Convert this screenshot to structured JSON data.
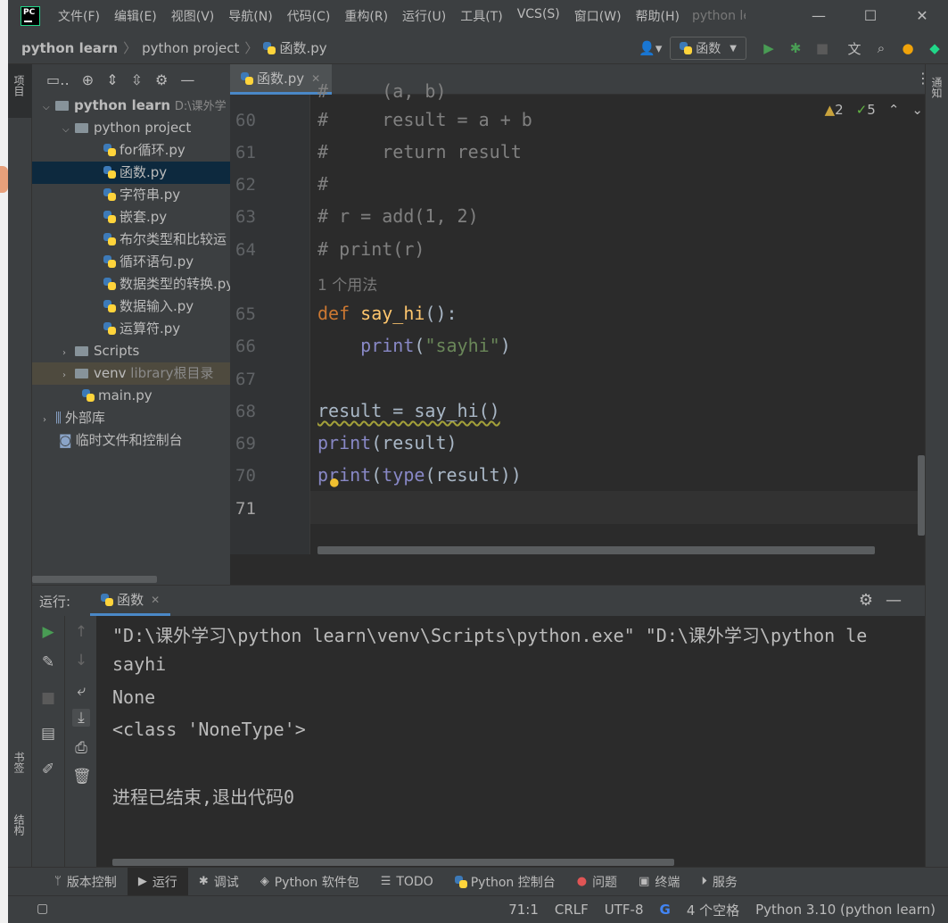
{
  "menu": [
    "文件(F)",
    "编辑(E)",
    "视图(V)",
    "导航(N)",
    "代码(C)",
    "重构(R)",
    "运行(U)",
    "工具(T)",
    "VCS(S)",
    "窗口(W)",
    "帮助(H)"
  ],
  "window_title": "python learn",
  "breadcrumb": {
    "root": "python learn",
    "folder": "python project",
    "file": "函数.py"
  },
  "run_config": "函数",
  "left_tabs": {
    "project": "项目",
    "bookmarks": "书签",
    "structure": "结构"
  },
  "right_tabs": {
    "notifications": "通知"
  },
  "project_tree": {
    "root": {
      "name": "python learn",
      "path": "D:\\课外学"
    },
    "folder": "python project",
    "files": [
      "for循环.py",
      "函数.py",
      "字符串.py",
      "嵌套.py",
      "布尔类型和比较运",
      "循环语句.py",
      "数据类型的转换.py",
      "数据输入.py",
      "运算符.py"
    ],
    "scripts": "Scripts",
    "venv": {
      "name": "venv",
      "note": "library根目录"
    },
    "main": "main.py",
    "external": "外部库",
    "scratches": "临时文件和控制台"
  },
  "editor": {
    "tab": "函数.py",
    "warnings": {
      "warn": "2",
      "ok": "5"
    },
    "usage_hint": "1 个用法",
    "line_numbers": [
      "60",
      "61",
      "62",
      "63",
      "64",
      "65",
      "66",
      "67",
      "68",
      "69",
      "70",
      "71"
    ],
    "code": {
      "l60": "#     result = a + b",
      "l61": "#     return result",
      "l62": "#",
      "l63": "# r = add(1, 2)",
      "l64": "# print(r)",
      "l65_kw": "def",
      "l65_fn": "say_hi",
      "l65_rest": "():",
      "l66_bi": "print",
      "l66_open": "(",
      "l66_str": "\"sayhi\"",
      "l66_close": ")",
      "l68": "result = say_hi()",
      "l69_bi": "print",
      "l69_rest": "(result)",
      "l70_bi": "print",
      "l70_open": "(",
      "l70_bi2": "type",
      "l70_rest": "(result))"
    }
  },
  "run_panel": {
    "label": "运行:",
    "tab": "函数",
    "output": [
      "\"D:\\课外学习\\python learn\\venv\\Scripts\\python.exe\" \"D:\\课外学习\\python le",
      "sayhi",
      "None",
      "<class 'NoneType'>",
      "",
      "进程已结束,退出代码0"
    ]
  },
  "tool_windows": [
    "版本控制",
    "运行",
    "调试",
    "Python 软件包",
    "TODO",
    "Python 控制台",
    "问题",
    "终端",
    "服务"
  ],
  "status": {
    "position": "71:1",
    "line_sep": "CRLF",
    "encoding": "UTF-8",
    "indent": "4 个空格",
    "interpreter": "Python 3.10 (python learn)"
  },
  "colors": {
    "keyword": "#cc7832",
    "function": "#ffc66d",
    "builtin": "#8888c6",
    "string": "#6a8759",
    "comment": "#808080",
    "selection": "#0d293e",
    "accent": "#4a88c7"
  }
}
